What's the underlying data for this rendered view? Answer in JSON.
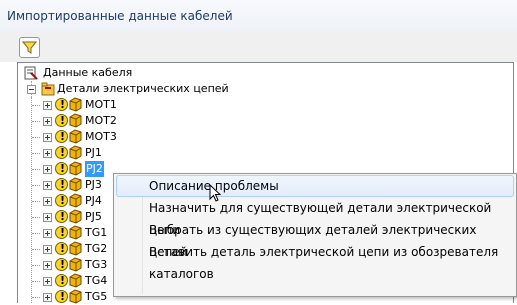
{
  "window": {
    "title": "Импортированные данные кабелей"
  },
  "toolbar": {
    "filter_icon": "filter-icon"
  },
  "tree": {
    "root_label": "Данные кабеля",
    "group_label": "Детали электрических цепей",
    "items": [
      {
        "label": "MOT1",
        "selected": false
      },
      {
        "label": "MOT2",
        "selected": false
      },
      {
        "label": "MOT3",
        "selected": false
      },
      {
        "label": "PJ1",
        "selected": false
      },
      {
        "label": "PJ2",
        "selected": true
      },
      {
        "label": "PJ3",
        "selected": false
      },
      {
        "label": "PJ4",
        "selected": false
      },
      {
        "label": "PJ5",
        "selected": false
      },
      {
        "label": "TG1",
        "selected": false
      },
      {
        "label": "TG2",
        "selected": false
      },
      {
        "label": "TG3",
        "selected": false
      },
      {
        "label": "TG4",
        "selected": false
      },
      {
        "label": "TG5",
        "selected": false
      }
    ]
  },
  "context_menu": {
    "items": [
      "Описание проблемы",
      "Назначить для существующей детали электрической цепи",
      "Выбрать из существующих деталей электрических цепей",
      "Вставить деталь электрической цепи из обозревателя каталогов"
    ],
    "hovered_index": 0
  },
  "colors": {
    "selection": "#3399ff",
    "title_text": "#1e3a6a",
    "warning": "#ffd22a",
    "cube": "#f2b400"
  }
}
